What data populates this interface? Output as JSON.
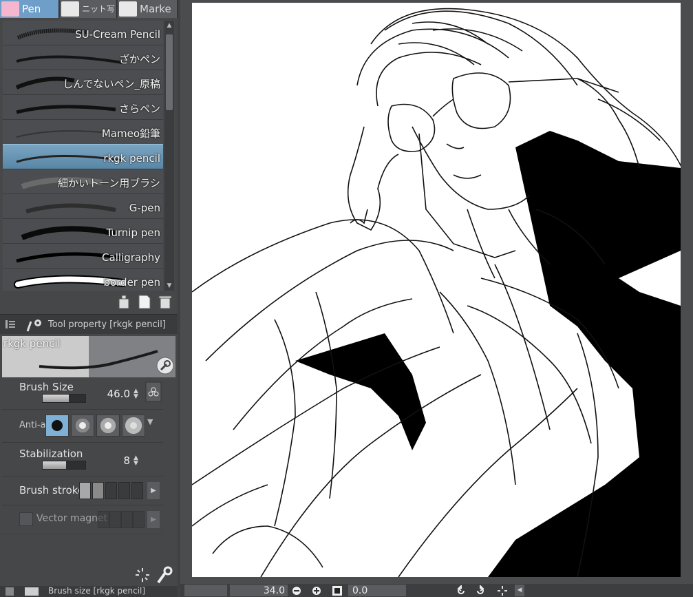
{
  "tool_tabs": [
    {
      "label": "Pen",
      "active": true
    },
    {
      "label": "ニット写",
      "active": false
    },
    {
      "label": "Marke",
      "active": false
    }
  ],
  "brushes": [
    {
      "name": "SU-Cream Pencil",
      "selected": false
    },
    {
      "name": "ざかペン",
      "selected": false
    },
    {
      "name": "しんでないペン_原稿",
      "selected": false
    },
    {
      "name": "さらペン",
      "selected": false
    },
    {
      "name": "Mameo鉛筆",
      "selected": false
    },
    {
      "name": "rkgk pencil",
      "selected": true
    },
    {
      "name": "細かいトーン用ブラシ",
      "selected": false
    },
    {
      "name": "G-pen",
      "selected": false
    },
    {
      "name": "Turnip pen",
      "selected": false
    },
    {
      "name": "Calligraphy",
      "selected": false
    },
    {
      "name": "border pen",
      "selected": false
    }
  ],
  "tool_property": {
    "title": "Tool property [rkgk pencil]",
    "brush_name": "rkgk pencil",
    "brush_size": {
      "label": "Brush Size",
      "value": "46.0",
      "slider_fraction": 0.62
    },
    "anti_aliasing": {
      "label": "Anti-a",
      "selected_index": 0
    },
    "stabilization": {
      "label": "Stabilization",
      "value": "8",
      "slider_fraction": 0.55
    },
    "brush_stroke": {
      "label": "Brush stroke",
      "selected_index": 1
    },
    "vector_magnet": {
      "label": "Vector magnet",
      "enabled": false
    }
  },
  "layer_panel": {
    "title": "Brush size [rkgk pencil]"
  },
  "status_bar": {
    "zoom": "34.0",
    "rotation": "0.0"
  },
  "colors": {
    "panel_bg": "#454749",
    "accent": "#6f9fc9",
    "selected_row": "#5a86a6",
    "canvas_bg": "#ffffff"
  }
}
